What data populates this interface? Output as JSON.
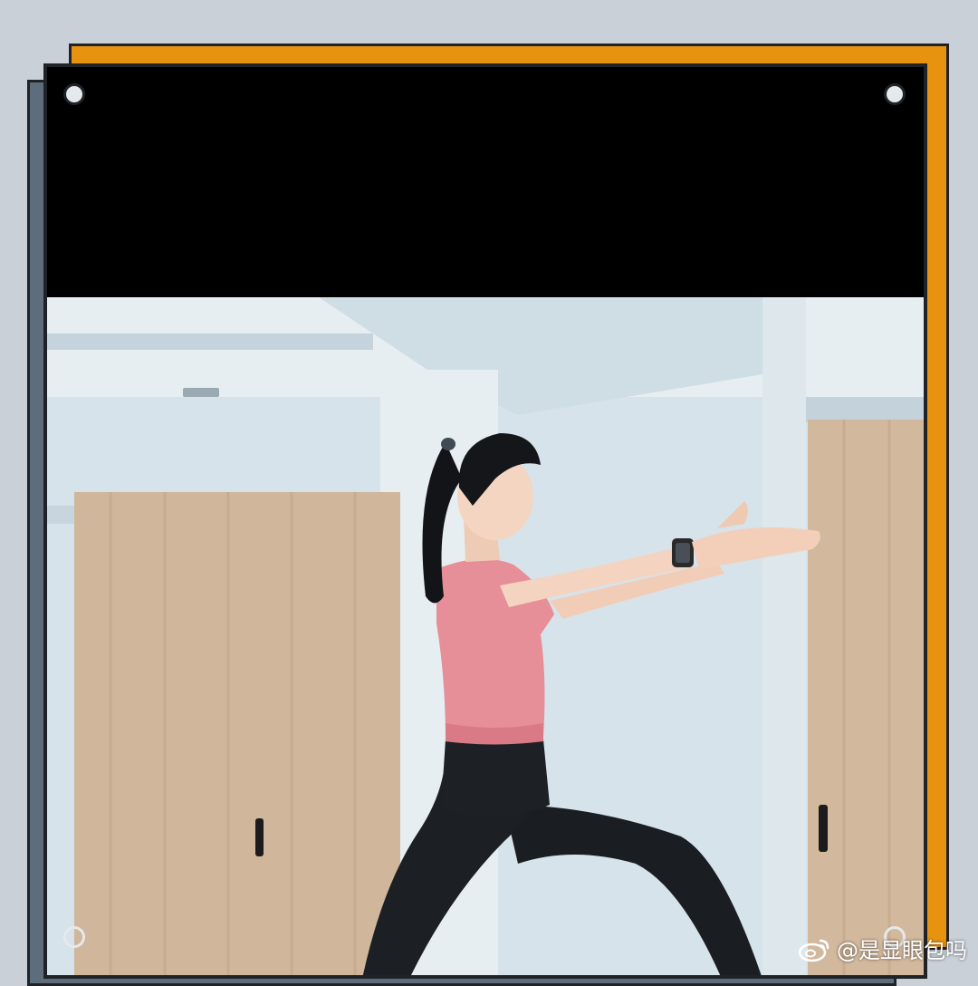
{
  "watermark": {
    "icon": "weibo-icon",
    "text": "@是显眼包吗"
  },
  "colors": {
    "page_background": "#c9d0d8",
    "frame_orange": "#e8930f",
    "frame_slate": "#5e6d7c",
    "frame_border": "#1f2327"
  }
}
